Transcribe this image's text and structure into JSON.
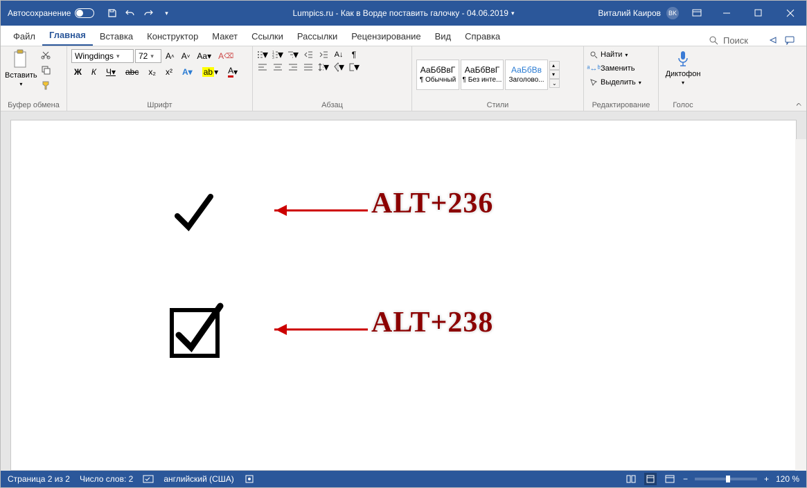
{
  "title": {
    "autosave": "Автосохранение",
    "doc": "Lumpics.ru - Как в Ворде поставить галочку - 04.06.2019",
    "user": "Виталий Каиров",
    "initials": "BK"
  },
  "tabs": {
    "file": "Файл",
    "home": "Главная",
    "insert": "Вставка",
    "design": "Конструктор",
    "layout": "Макет",
    "references": "Ссылки",
    "mailings": "Рассылки",
    "review": "Рецензирование",
    "view": "Вид",
    "help": "Справка",
    "search": "Поиск"
  },
  "groups": {
    "clipboard": "Буфер обмена",
    "font": "Шрифт",
    "paragraph": "Абзац",
    "styles": "Стили",
    "editing": "Редактирование",
    "voice": "Голос"
  },
  "clipboard": {
    "paste": "Вставить"
  },
  "font": {
    "name": "Wingdings",
    "size": "72",
    "bold": "Ж",
    "italic": "К",
    "underline": "Ч",
    "strike": "abc",
    "sub": "x₂",
    "sup": "x²",
    "caps": "Aa",
    "clear": "A"
  },
  "styles": {
    "s1": "АаБбВвГ",
    "s1label": "¶ Обычный",
    "s2": "АаБбВвГ",
    "s2label": "¶ Без инте...",
    "s3": "АаБбВв",
    "s3label": "Заголово..."
  },
  "editing": {
    "find": "Найти",
    "replace": "Заменить",
    "select": "Выделить"
  },
  "voice": {
    "dictate": "Диктофон"
  },
  "document": {
    "annot1": "ALT+236",
    "annot2": "ALT+238"
  },
  "status": {
    "page": "Страница 2 из 2",
    "words": "Число слов: 2",
    "lang": "английский (США)",
    "zoom": "120 %"
  }
}
